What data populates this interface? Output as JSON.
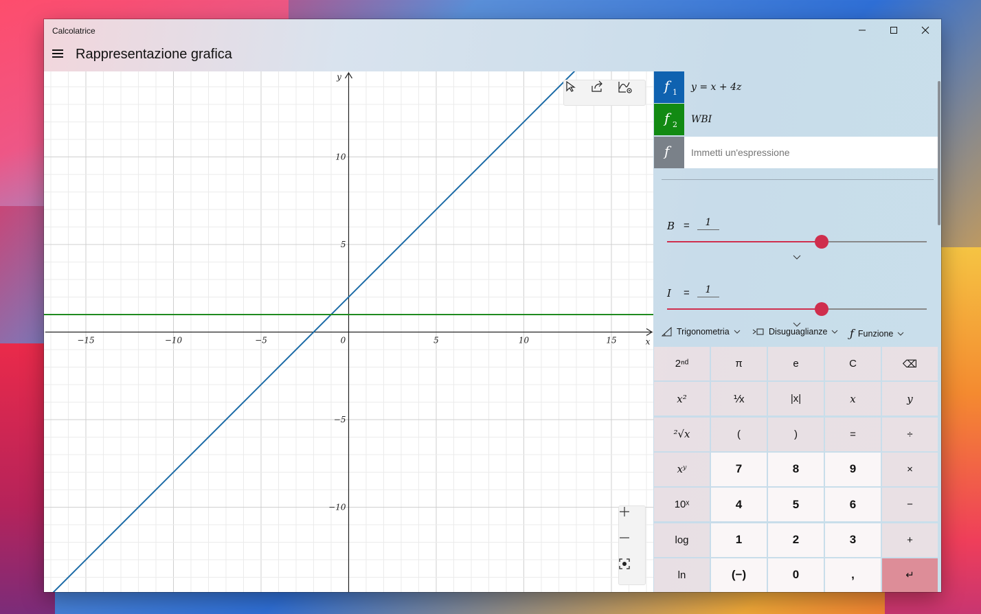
{
  "window": {
    "app_title": "Calcolatrice",
    "page_title": "Rappresentazione grafica"
  },
  "graph": {
    "axis_x_label": "x",
    "axis_y_label": "y",
    "x_ticks": [
      "−15",
      "−10",
      "−5",
      "0",
      "5",
      "10",
      "15"
    ],
    "y_ticks": [
      "10",
      "5",
      "−5",
      "−10"
    ],
    "line1_color": "#1a6aa6",
    "line2_color": "#1f8a1f"
  },
  "functions": [
    {
      "badge": "f",
      "index": "1",
      "expression": "y = x + 4z",
      "color": "#0f62b0"
    },
    {
      "badge": "f",
      "index": "2",
      "expression": "WBI",
      "color": "#128a13"
    },
    {
      "badge": "f",
      "placeholder": "Immetti un'espressione",
      "color": "#7a8189"
    }
  ],
  "variables": [
    {
      "name": "B",
      "equals": "=",
      "value": "1",
      "slider_fraction": 0.595
    },
    {
      "name": "I",
      "equals": "=",
      "value": "1",
      "slider_fraction": 0.595
    }
  ],
  "categories": [
    {
      "label": "Trigonometria",
      "icon": "triangle-ruler-icon"
    },
    {
      "label": "Disuguaglianze",
      "icon": "inequality-icon"
    },
    {
      "label": "Funzione",
      "icon": "function-icon"
    }
  ],
  "keypad": {
    "rows": [
      [
        "2ⁿᵈ",
        "π",
        "e",
        "C",
        "⌫"
      ],
      [
        "x²",
        "⅟x",
        "|x|",
        "x",
        "y"
      ],
      [
        "²√x",
        "(",
        ")",
        "=",
        "÷"
      ],
      [
        "xʸ",
        "7",
        "8",
        "9",
        "×"
      ],
      [
        "10ˣ",
        "4",
        "5",
        "6",
        "−"
      ],
      [
        "log",
        "1",
        "2",
        "3",
        "+"
      ],
      [
        "ln",
        "(−)",
        "0",
        ",",
        "↵"
      ]
    ]
  },
  "accent_color": "#cf2e4d"
}
